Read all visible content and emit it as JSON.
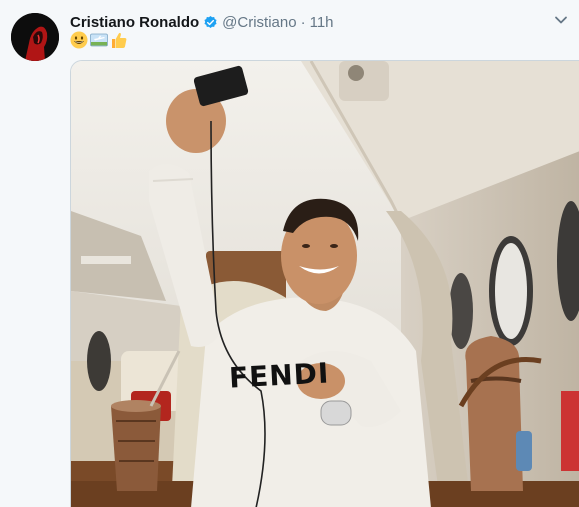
{
  "tweet": {
    "author_name": "Cristiano Ronaldo",
    "handle": "@Cristiano",
    "separator": "·",
    "time": "11h",
    "verified": true,
    "text_emojis": [
      "grinning-face-emoji",
      "airplane-image-emoji",
      "thumbs-up-emoji"
    ],
    "image": {
      "sweater_text": "FENDI"
    }
  },
  "colors": {
    "background": "#f5f8fa",
    "name": "#14171a",
    "secondary": "#657786",
    "verified": "#1da1f2"
  }
}
